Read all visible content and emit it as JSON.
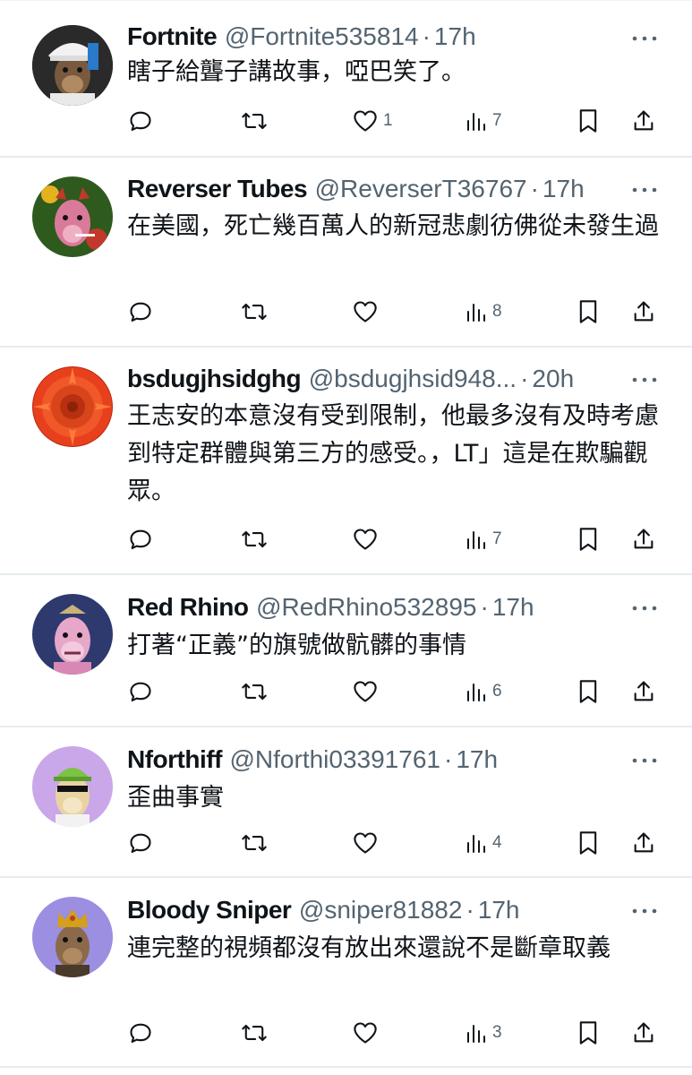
{
  "posts": [
    {
      "name": "Fortnite",
      "handle": "@Fortnite535814",
      "separator": "·",
      "time": "17h",
      "text": "瞎子給聾子講故事，啞巴笑了。",
      "likes": "1",
      "views": "7",
      "avatar": {
        "bg": "#e8e8e8",
        "figure": "#8a6a4a",
        "accent": "#f2f2f2"
      }
    },
    {
      "name": "Reverser Tubes",
      "handle": "@ReverserT36767",
      "separator": "·",
      "time": "17h",
      "text": "在美國，死亡幾百萬人的新冠悲劇彷佛從未發生過",
      "likes": "",
      "views": "8",
      "avatar": {
        "bg": "#2f5a1e",
        "figure": "#d97a9a",
        "accent": "#c0392b"
      }
    },
    {
      "name": "bsdugjhsidghg",
      "handle": "@bsdugjhsid948...",
      "separator": "·",
      "time": "20h",
      "text": "王志安的本意沒有受到限制，他最多沒有及時考慮到特定群體與第三方的感受。，LT」這是在欺騙觀眾。",
      "likes": "",
      "views": "7",
      "avatar": {
        "bg": "#e8401c",
        "figure": "#c0300f",
        "accent": "#ff7a3a"
      }
    },
    {
      "name": "Red Rhino",
      "handle": "@RedRhino532895",
      "separator": "·",
      "time": "17h",
      "text": "打著“正義”的旗號做骯髒的事情",
      "likes": "",
      "views": "6",
      "avatar": {
        "bg": "#2e3a6e",
        "figure": "#e6a7c9",
        "accent": "#c8b27a"
      }
    },
    {
      "name": "Nforthiff",
      "handle": "@Nforthi03391761",
      "separator": "·",
      "time": "17h",
      "text": "歪曲事實",
      "likes": "",
      "views": "4",
      "avatar": {
        "bg": "#c9a7e8",
        "figure": "#e9d3a3",
        "accent": "#7cc243"
      }
    },
    {
      "name": "Bloody Sniper",
      "handle": "@sniper81882",
      "separator": "·",
      "time": "17h",
      "text": "連完整的視頻都沒有放出來還說不是斷章取義",
      "likes": "",
      "views": "3",
      "avatar": {
        "bg": "#9c8ee0",
        "figure": "#8a6a4a",
        "accent": "#d4a017"
      }
    }
  ],
  "icons": [
    "reply-icon",
    "retweet-icon",
    "like-icon",
    "views-icon",
    "bookmark-icon",
    "share-icon",
    "more-icon"
  ],
  "colors": {
    "text": "#0f1419",
    "secondary": "#536471",
    "divider": "#e6ecf0"
  }
}
